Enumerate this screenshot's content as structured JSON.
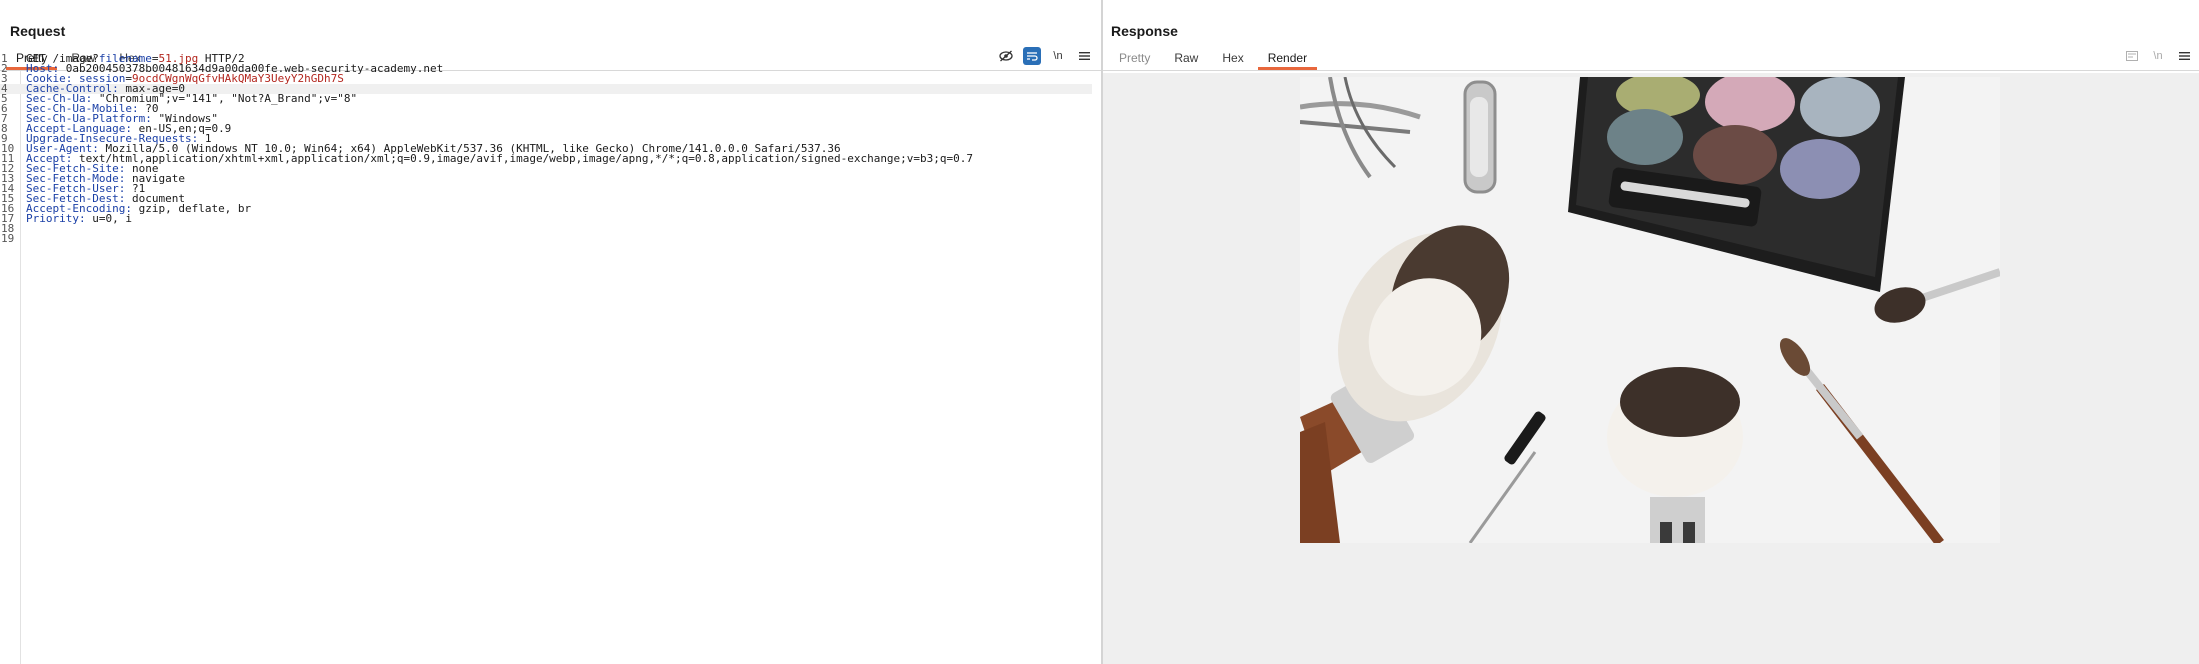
{
  "request": {
    "title": "Request",
    "tabs": [
      {
        "label": "Pretty"
      },
      {
        "label": "Raw"
      },
      {
        "label": "Hex"
      }
    ],
    "active_tab": "Pretty",
    "tools": {
      "newline_label": "\\n"
    },
    "lines": [
      {
        "n": "1",
        "parts": [
          [
            "GET /image?",
            ""
          ],
          [
            "filename",
            "k"
          ],
          [
            "=",
            ""
          ],
          [
            "51.jpg",
            "r"
          ],
          [
            " HTTP/2",
            ""
          ]
        ]
      },
      {
        "n": "2",
        "parts": [
          [
            "Host: ",
            "k"
          ],
          [
            "0ab200450378b00481634d9a00da00fe.web-security-academy.net",
            ""
          ]
        ]
      },
      {
        "n": "3",
        "parts": [
          [
            "Cookie: ",
            "k"
          ],
          [
            "session",
            "k"
          ],
          [
            "=",
            ""
          ],
          [
            "9ocdCWgnWqGfvHAkQMaY3UeyY2hGDh7S",
            "r"
          ]
        ]
      },
      {
        "n": "4",
        "parts": [
          [
            "Cache-Control: ",
            "k"
          ],
          [
            "max-age=0",
            ""
          ]
        ]
      },
      {
        "n": "5",
        "parts": [
          [
            "Sec-Ch-Ua: ",
            "k"
          ],
          [
            "\"Chromium\";v=\"141\", \"Not?A_Brand\";v=\"8\"",
            ""
          ]
        ]
      },
      {
        "n": "6",
        "parts": [
          [
            "Sec-Ch-Ua-Mobile: ",
            "k"
          ],
          [
            "?0",
            ""
          ]
        ]
      },
      {
        "n": "7",
        "parts": [
          [
            "Sec-Ch-Ua-Platform: ",
            "k"
          ],
          [
            "\"Windows\"",
            ""
          ]
        ]
      },
      {
        "n": "8",
        "parts": [
          [
            "Accept-Language: ",
            "k"
          ],
          [
            "en-US,en;q=0.9",
            ""
          ]
        ]
      },
      {
        "n": "9",
        "parts": [
          [
            "Upgrade-Insecure-Requests: ",
            "k"
          ],
          [
            "1",
            ""
          ]
        ]
      },
      {
        "n": "10",
        "parts": [
          [
            "User-Agent: ",
            "k"
          ],
          [
            "Mozilla/5.0 (Windows NT 10.0; Win64; x64) AppleWebKit/537.36 (KHTML, like Gecko) Chrome/141.0.0.0 Safari/537.36",
            ""
          ]
        ]
      },
      {
        "n": "11",
        "parts": [
          [
            "Accept: ",
            "k"
          ],
          [
            "text/html,application/xhtml+xml,application/xml;q=0.9,image/avif,image/webp,image/apng,*/*;q=0.8,application/signed-exchange;v=b3;q=0.7",
            ""
          ]
        ]
      },
      {
        "n": "12",
        "parts": [
          [
            "Sec-Fetch-Site: ",
            "k"
          ],
          [
            "none",
            ""
          ]
        ]
      },
      {
        "n": "13",
        "parts": [
          [
            "Sec-Fetch-Mode: ",
            "k"
          ],
          [
            "navigate",
            ""
          ]
        ]
      },
      {
        "n": "14",
        "parts": [
          [
            "Sec-Fetch-User: ",
            "k"
          ],
          [
            "?1",
            ""
          ]
        ]
      },
      {
        "n": "15",
        "parts": [
          [
            "Sec-Fetch-Dest: ",
            "k"
          ],
          [
            "document",
            ""
          ]
        ]
      },
      {
        "n": "16",
        "parts": [
          [
            "Accept-Encoding: ",
            "k"
          ],
          [
            "gzip, deflate, br",
            ""
          ]
        ]
      },
      {
        "n": "17",
        "parts": [
          [
            "Priority: ",
            "k"
          ],
          [
            "u=0, i",
            ""
          ]
        ]
      },
      {
        "n": "18",
        "parts": []
      },
      {
        "n": "19",
        "parts": []
      }
    ],
    "current_line": "4"
  },
  "response": {
    "title": "Response",
    "tabs": [
      {
        "label": "Pretty"
      },
      {
        "label": "Raw"
      },
      {
        "label": "Hex"
      },
      {
        "label": "Render"
      }
    ],
    "active_tab": "Render",
    "tools": {
      "newline_label": "\\n"
    },
    "render_image": "makeup-brushes-and-eyeshadow-palette"
  },
  "colors": {
    "accent": "#e8673c",
    "toggle_on": "#2a6fb7",
    "header_name": "#1a3fa6",
    "header_value_highlight": "#b3261e"
  }
}
